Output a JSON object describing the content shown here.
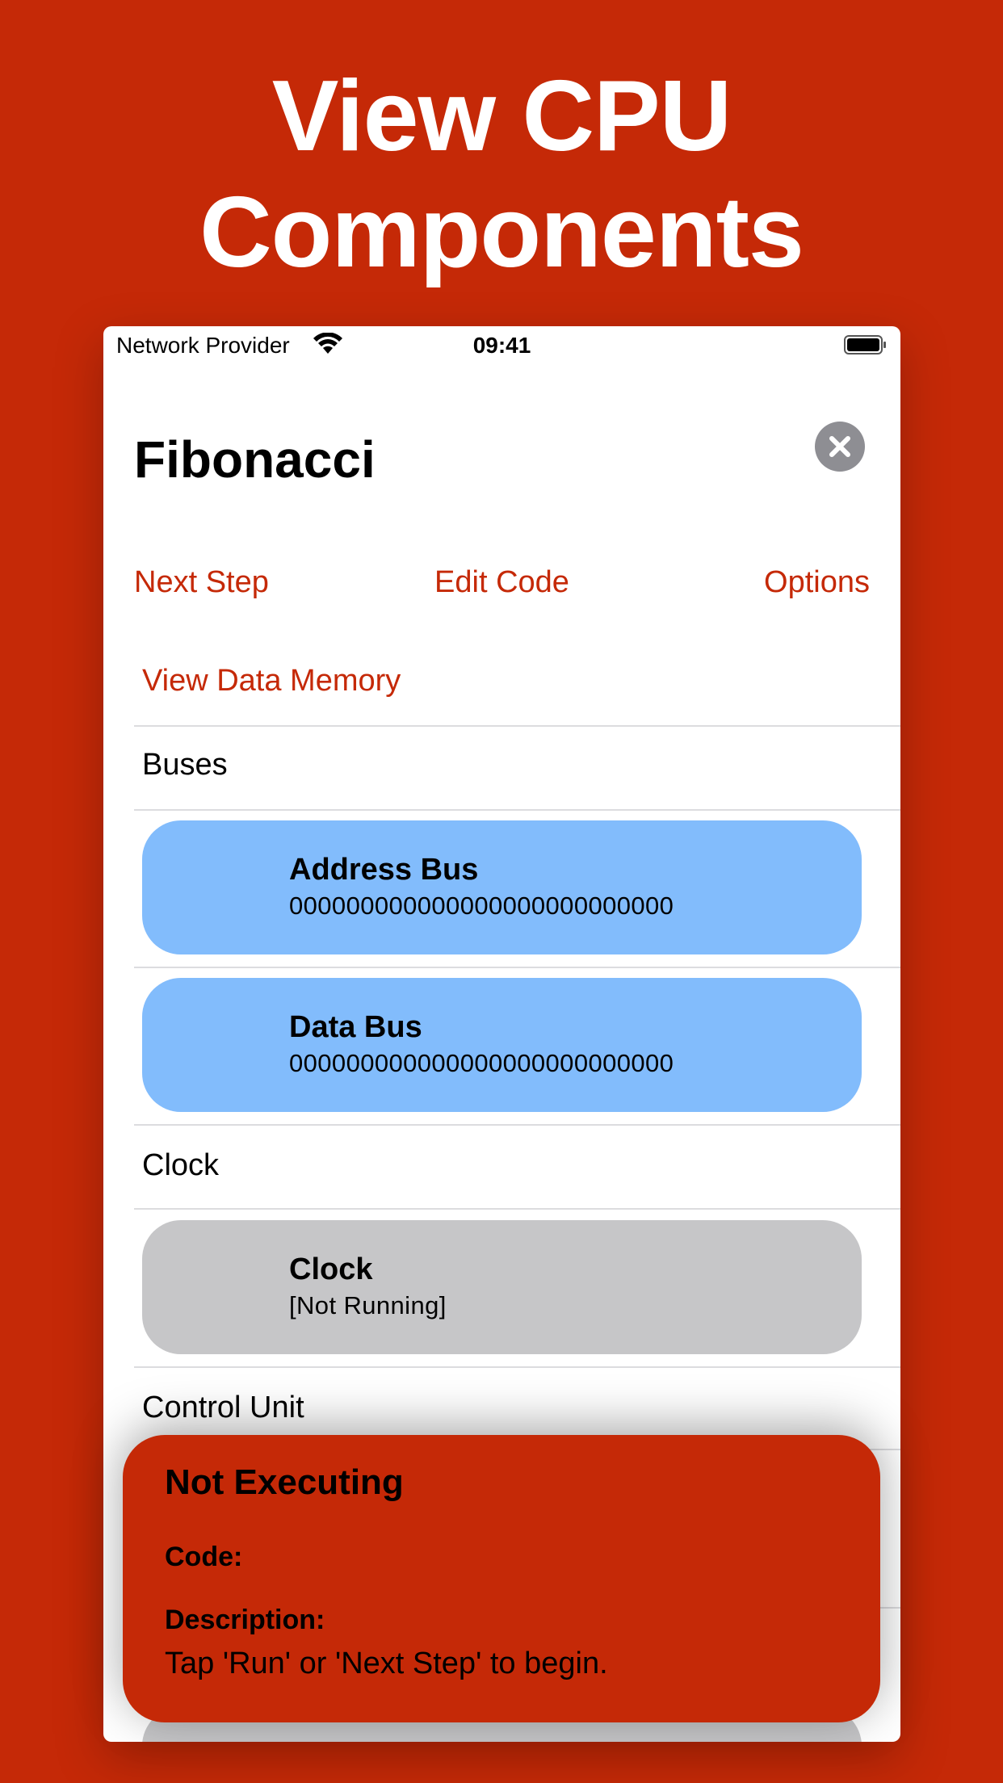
{
  "headline": {
    "line1": "View CPU",
    "line2": "Components"
  },
  "status_bar": {
    "carrier": "Network Provider",
    "time": "09:41"
  },
  "nav": {
    "title": "Fibonacci"
  },
  "toolbar": {
    "next_step": "Next Step",
    "edit_code": "Edit Code",
    "options": "Options"
  },
  "list": {
    "view_data_memory": "View Data Memory",
    "sections": {
      "buses": "Buses",
      "clock": "Clock",
      "control_unit": "Control Unit"
    },
    "cards": [
      {
        "title": "Address Bus",
        "value": "000000000000000000000000000",
        "color": "#82bcfc"
      },
      {
        "title": "Data Bus",
        "value": "000000000000000000000000000",
        "color": "#82bcfc"
      },
      {
        "title": "Clock",
        "value": "[Not Running]",
        "color": "#c6c6c8"
      }
    ]
  },
  "popup": {
    "title": "Not Executing",
    "code_label": "Code:",
    "description_label": "Description:",
    "description": "Tap 'Run' or 'Next Step' to begin."
  },
  "colors": {
    "accent": "#c52907",
    "bus": "#82bcfc",
    "clock": "#c6c6c8"
  }
}
